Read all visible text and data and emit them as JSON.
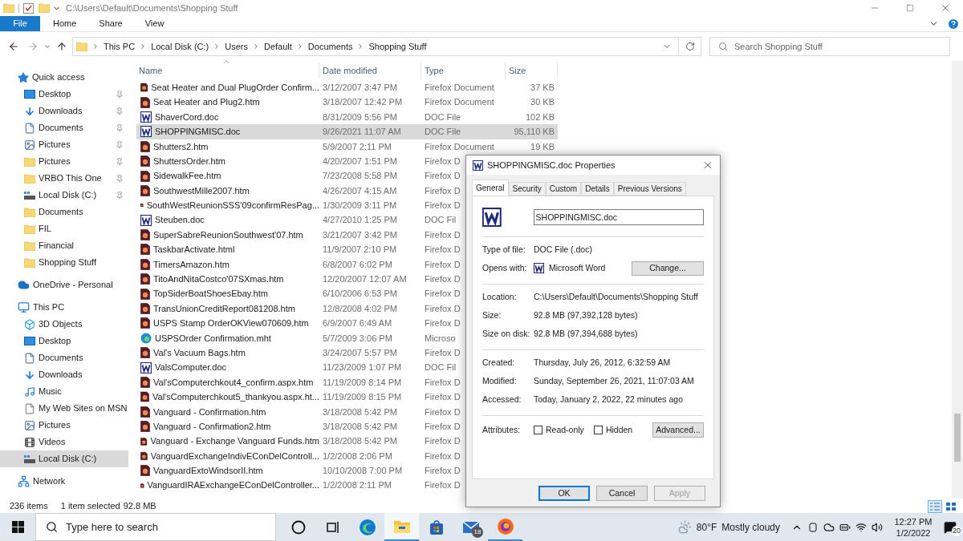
{
  "window": {
    "title": "C:\\Users\\Default\\Documents\\Shopping Stuff"
  },
  "ribbon_tabs": [
    {
      "label": "File",
      "kind": "backstage"
    },
    {
      "label": "Home",
      "kind": "tab"
    },
    {
      "label": "Share",
      "kind": "tab"
    },
    {
      "label": "View",
      "kind": "tab"
    }
  ],
  "address_bar": {
    "breadcrumbs": [
      "This PC",
      "Local Disk (C:)",
      "Users",
      "Default",
      "Documents",
      "Shopping Stuff"
    ]
  },
  "search": {
    "placeholder": "Search Shopping Stuff"
  },
  "sidebar": {
    "sections": [
      {
        "label": "Quick access",
        "kind": "star",
        "selected": false,
        "items": [
          {
            "label": "Desktop",
            "kind": "desktop",
            "pinned": true,
            "selected": false
          },
          {
            "label": "Downloads",
            "kind": "download",
            "pinned": true,
            "selected": false
          },
          {
            "label": "Documents",
            "kind": "document",
            "pinned": true,
            "selected": false
          },
          {
            "label": "Pictures",
            "kind": "pictures",
            "pinned": true,
            "selected": false
          },
          {
            "label": "Pictures",
            "kind": "folder",
            "pinned": true,
            "selected": false
          },
          {
            "label": "VRBO This One",
            "kind": "folder",
            "pinned": true,
            "selected": false
          },
          {
            "label": "Local Disk (C:)",
            "kind": "disk",
            "pinned": true,
            "selected": false
          },
          {
            "label": "Documents",
            "kind": "folder",
            "pinned": false,
            "selected": false
          },
          {
            "label": "FIL",
            "kind": "folder",
            "pinned": false,
            "selected": false
          },
          {
            "label": "Financial",
            "kind": "folder",
            "pinned": false,
            "selected": false
          },
          {
            "label": "Shopping Stuff",
            "kind": "folder",
            "pinned": false,
            "selected": false
          }
        ]
      },
      {
        "label": "OneDrive - Personal",
        "kind": "cloud",
        "selected": false
      },
      {
        "label": "This PC",
        "kind": "pc",
        "selected": false,
        "items": [
          {
            "label": "3D Objects",
            "kind": "cube",
            "selected": false
          },
          {
            "label": "Desktop",
            "kind": "desktop",
            "selected": false
          },
          {
            "label": "Documents",
            "kind": "document",
            "selected": false
          },
          {
            "label": "Downloads",
            "kind": "download",
            "selected": false
          },
          {
            "label": "Music",
            "kind": "music",
            "selected": false
          },
          {
            "label": "My Web Sites on MSN",
            "kind": "page",
            "selected": false
          },
          {
            "label": "Pictures",
            "kind": "pictures",
            "selected": false
          },
          {
            "label": "Videos",
            "kind": "videos",
            "selected": false
          },
          {
            "label": "Local Disk (C:)",
            "kind": "disk",
            "selected": true
          }
        ]
      },
      {
        "label": "Network",
        "kind": "network",
        "selected": false
      }
    ]
  },
  "file_list": {
    "columns": [
      {
        "label": "Name",
        "sorted": true
      },
      {
        "label": "Date modified",
        "sorted": false
      },
      {
        "label": "Type",
        "sorted": false
      },
      {
        "label": "Size",
        "sorted": false
      }
    ],
    "rows": [
      {
        "name": "Seat Heater and Dual PlugOrder Confirm...",
        "date": "3/12/2007 3:47 PM",
        "type": "Firefox Document",
        "size": "37 KB",
        "kind": "firefox",
        "selected": false
      },
      {
        "name": "Seat Heater and Plug2.htm",
        "date": "3/18/2007 12:42 PM",
        "type": "Firefox Document",
        "size": "30 KB",
        "kind": "firefox",
        "selected": false
      },
      {
        "name": "ShaverCord.doc",
        "date": "8/31/2009 5:56 PM",
        "type": "DOC File",
        "size": "102 KB",
        "kind": "word",
        "selected": false
      },
      {
        "name": "SHOPPINGMISC.doc",
        "date": "9/26/2021 11:07 AM",
        "type": "DOC File",
        "size": "95,110 KB",
        "kind": "word",
        "selected": true
      },
      {
        "name": "Shutters2.htm",
        "date": "5/9/2007 2:11 PM",
        "type": "Firefox Document",
        "size": "19 KB",
        "kind": "firefox",
        "selected": false
      },
      {
        "name": "ShuttersOrder.htm",
        "date": "4/20/2007 1:51 PM",
        "type": "Firefox D",
        "kind": "firefox",
        "selected": false
      },
      {
        "name": "SidewalkFee.htm",
        "date": "7/23/2008 5:58 PM",
        "type": "Firefox D",
        "kind": "firefox",
        "selected": false
      },
      {
        "name": "SouthwestMille2007.htm",
        "date": "4/26/2007 4:15 AM",
        "type": "Firefox D",
        "kind": "firefox",
        "selected": false
      },
      {
        "name": "SouthWestReunionSSS'09confirmResPag...",
        "date": "1/30/2009 3:11 PM",
        "type": "Firefox D",
        "kind": "firefox",
        "selected": false
      },
      {
        "name": "Steuben.doc",
        "date": "4/27/2010 1:25 PM",
        "type": "DOC Fil",
        "kind": "word",
        "selected": false
      },
      {
        "name": "SuperSabreReunionSouthwest'07.htm",
        "date": "3/21/2007 3:42 PM",
        "type": "Firefox D",
        "kind": "firefox",
        "selected": false
      },
      {
        "name": "TaskbarActivate.html",
        "date": "11/9/2007 2:10 PM",
        "type": "Firefox D",
        "kind": "firefox",
        "selected": false
      },
      {
        "name": "TimersAmazon.htm",
        "date": "6/8/2007 6:02 PM",
        "type": "Firefox D",
        "kind": "firefox",
        "selected": false
      },
      {
        "name": "TitoAndNitaCostco'07SXmas.htm",
        "date": "12/20/2007 12:07 AM",
        "type": "Firefox D",
        "kind": "firefox",
        "selected": false
      },
      {
        "name": "TopSiderBoatShoesEbay.htm",
        "date": "6/10/2006 6:53 PM",
        "type": "Firefox D",
        "kind": "firefox",
        "selected": false
      },
      {
        "name": "TransUnionCreditReport081208.htm",
        "date": "12/8/2008 4:02 PM",
        "type": "Firefox D",
        "kind": "firefox",
        "selected": false
      },
      {
        "name": "USPS Stamp OrderOKView070609.htm",
        "date": "6/9/2007 6:49 AM",
        "type": "Firefox D",
        "kind": "firefox",
        "selected": false
      },
      {
        "name": "USPSOrder Confirmation.mht",
        "date": "5/7/2009 3:06 PM",
        "type": "Microso",
        "kind": "edge",
        "selected": false
      },
      {
        "name": "Val's Vacuum Bags.htm",
        "date": "3/24/2007 5:57 PM",
        "type": "Firefox D",
        "kind": "firefox",
        "selected": false
      },
      {
        "name": "ValsComputer.doc",
        "date": "11/23/2009 1:07 PM",
        "type": "DOC Fil",
        "kind": "word",
        "selected": false
      },
      {
        "name": "Val'sComputerchkout4_confirm.aspx.htm",
        "date": "11/19/2009 8:14 PM",
        "type": "Firefox D",
        "kind": "firefox",
        "selected": false
      },
      {
        "name": "Val'sComputerchkout5_thankyou.aspx.ht...",
        "date": "11/19/2009 8:15 PM",
        "type": "Firefox D",
        "kind": "firefox",
        "selected": false
      },
      {
        "name": "Vanguard - Confirmation.htm",
        "date": "3/18/2008 5:42 PM",
        "type": "Firefox D",
        "kind": "firefox",
        "selected": false
      },
      {
        "name": "Vanguard - Confirmation2.htm",
        "date": "3/18/2008 5:42 PM",
        "type": "Firefox D",
        "kind": "firefox",
        "selected": false
      },
      {
        "name": "Vanguard - Exchange Vanguard Funds.htm",
        "date": "3/18/2008 5:42 PM",
        "type": "Firefox D",
        "kind": "firefox",
        "selected": false
      },
      {
        "name": "VanguardExchangeIndivEConDelControll...",
        "date": "1/2/2008 2:06 PM",
        "type": "Firefox D",
        "kind": "firefox",
        "selected": false
      },
      {
        "name": "VanguardExtoWindsorII.htm",
        "date": "10/10/2008 7:00 PM",
        "type": "Firefox D",
        "kind": "firefox",
        "selected": false
      },
      {
        "name": "VanguardIRAExchangeEConDelController...",
        "date": "1/2/2008 2:11 PM",
        "type": "Firefox D",
        "kind": "firefox",
        "selected": false
      }
    ]
  },
  "status_bar": {
    "item_count": "236 items",
    "selection": "1 item selected",
    "selection_size": "92.8 MB",
    "view_buttons": [
      {
        "kind": "details",
        "selected": true
      },
      {
        "kind": "tiles",
        "selected": false
      }
    ]
  },
  "properties_dialog": {
    "title": "SHOPPINGMISC.doc Properties",
    "tabs": [
      {
        "label": "General",
        "selected": true
      },
      {
        "label": "Security",
        "selected": false
      },
      {
        "label": "Custom",
        "selected": false
      },
      {
        "label": "Details",
        "selected": false
      },
      {
        "label": "Previous Versions",
        "selected": false
      }
    ],
    "file_name": {
      "value": "SHOPPINGMISC.doc"
    },
    "groups": [
      [
        {
          "label": "Type of file:",
          "value": "DOC File (.doc)",
          "kind": "text"
        },
        {
          "label": "Opens with:",
          "value": "Microsoft Word",
          "kind": "app",
          "button": "Change..."
        }
      ],
      [
        {
          "label": "Location:",
          "value": "C:\\Users\\Default\\Documents\\Shopping Stuff",
          "kind": "text"
        },
        {
          "label": "Size:",
          "value": "92.8 MB (97,392,128 bytes)",
          "kind": "text"
        },
        {
          "label": "Size on disk:",
          "value": "92.8 MB (97,394,688 bytes)",
          "kind": "text"
        }
      ],
      [
        {
          "label": "Created:",
          "value": "Thursday, July 26, 2012, 6:32:59 AM",
          "kind": "text"
        },
        {
          "label": "Modified:",
          "value": "Sunday, September 26, 2021, 11:07:03 AM",
          "kind": "text"
        },
        {
          "label": "Accessed:",
          "value": "Today, January 2, 2022, 22 minutes ago",
          "kind": "text"
        }
      ]
    ],
    "attributes": {
      "label": "Attributes:",
      "checkboxes": [
        {
          "label": "Read-only",
          "checked": false
        },
        {
          "label": "Hidden",
          "checked": false
        }
      ],
      "button": "Advanced..."
    },
    "buttons": [
      {
        "label": "OK",
        "default": true,
        "disabled": false
      },
      {
        "label": "Cancel",
        "default": false,
        "disabled": false
      },
      {
        "label": "Apply",
        "default": false,
        "disabled": true
      }
    ]
  },
  "taskbar": {
    "search": {
      "placeholder": "Type here to search"
    },
    "apps": [
      {
        "kind": "cortana",
        "active": false,
        "running": false
      },
      {
        "kind": "taskview",
        "active": false,
        "running": false
      },
      {
        "kind": "edge",
        "active": false,
        "running": false
      },
      {
        "kind": "explorer",
        "active": true,
        "running": true
      },
      {
        "kind": "store",
        "active": false,
        "running": false
      },
      {
        "kind": "mail",
        "active": false,
        "running": false,
        "badge": "18"
      },
      {
        "kind": "firefox",
        "active": false,
        "running": true
      }
    ],
    "weather": {
      "temperature": "80°F",
      "condition": "Mostly cloudy"
    },
    "clock": {
      "time": "12:27 PM",
      "date": "1/2/2022"
    },
    "notifications": {
      "count": "20"
    }
  }
}
